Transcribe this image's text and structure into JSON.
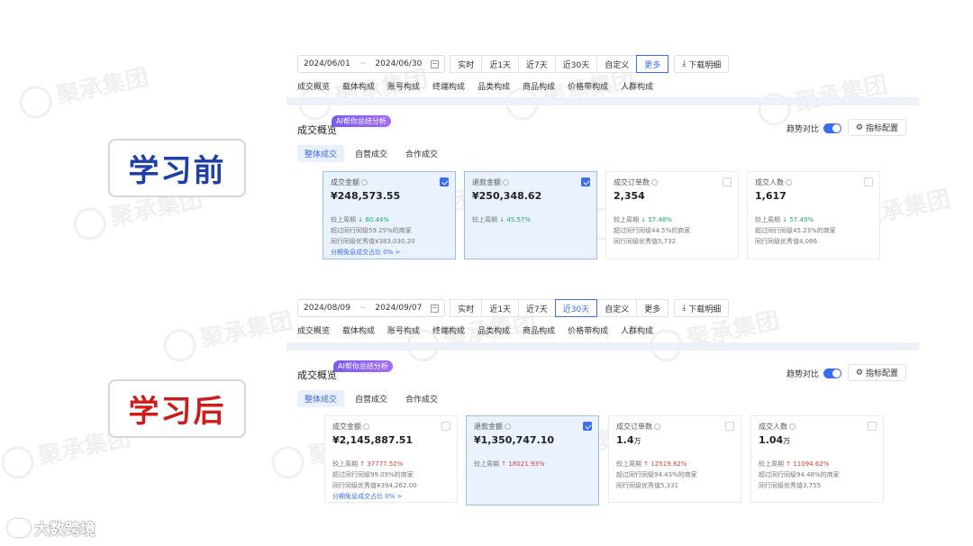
{
  "labels": {
    "before": "学习前",
    "after": "学习后"
  },
  "watermark_text": "聚承集团",
  "footer": {
    "text": "大数跨境"
  },
  "panels": [
    {
      "date_start": "2024/06/01",
      "date_end": "2024/06/30",
      "ranges": [
        "实时",
        "近1天",
        "近7天",
        "近30天",
        "自定义",
        "更多"
      ],
      "active_range": 5,
      "download": "下载明细",
      "subtabs": [
        "成交概览",
        "载体构成",
        "账号构成",
        "终端构成",
        "品类构成",
        "商品构成",
        "价格带构成",
        "人群构成"
      ],
      "section_title": "成交概览",
      "ai_badge": "AI帮你总结分析",
      "trend_label": "趋势对比",
      "config_label": "指标配置",
      "content_tabs": [
        "整体成交",
        "自营成交",
        "合作成交"
      ],
      "cards": [
        {
          "title": "成交金额",
          "value": "¥248,573.55",
          "unit": "",
          "selected": true,
          "change_prefix": "较上周期",
          "change": "60.44%",
          "direction": "down",
          "lines": [
            "超过同行同级59.25%的商家",
            "同行同级优秀值¥383,030.20"
          ],
          "link": "分期免息成交占比 0% >"
        },
        {
          "title": "退款金额",
          "value": "¥250,348.62",
          "unit": "",
          "selected": true,
          "change_prefix": "较上周期",
          "change": "45.57%",
          "direction": "down",
          "lines": [],
          "link": ""
        },
        {
          "title": "成交订单数",
          "value": "2,354",
          "unit": "",
          "selected": false,
          "change_prefix": "较上周期",
          "change": "57.48%",
          "direction": "down",
          "lines": [
            "超过同行同级44.5%的商家",
            "同行同级优秀值5,732"
          ],
          "link": ""
        },
        {
          "title": "成交人数",
          "value": "1,617",
          "unit": "",
          "selected": false,
          "change_prefix": "较上周期",
          "change": "57.49%",
          "direction": "down",
          "lines": [
            "超过同行同级45.23%的商家",
            "同行同级优秀值4,066"
          ],
          "link": ""
        }
      ]
    },
    {
      "date_start": "2024/08/09",
      "date_end": "2024/09/07",
      "ranges": [
        "实时",
        "近1天",
        "近7天",
        "近30天",
        "自定义",
        "更多"
      ],
      "active_range": 3,
      "download": "下载明细",
      "subtabs": [
        "成交概览",
        "载体构成",
        "账号构成",
        "终端构成",
        "品类构成",
        "商品构成",
        "价格带构成",
        "人群构成"
      ],
      "section_title": "成交概览",
      "ai_badge": "AI帮你总结分析",
      "trend_label": "趋势对比",
      "config_label": "指标配置",
      "content_tabs": [
        "整体成交",
        "自营成交",
        "合作成交"
      ],
      "cards": [
        {
          "title": "成交金额",
          "value": "¥2,145,887.51",
          "unit": "",
          "selected": false,
          "change_prefix": "较上周期",
          "change": "37777.52%",
          "direction": "up",
          "lines": [
            "超过同行同级99.09%的商家",
            "同行同级优秀值¥394,262.00"
          ],
          "link": "分期免息成交占比 0% >"
        },
        {
          "title": "退款金额",
          "value": "¥1,350,747.10",
          "unit": "",
          "selected": true,
          "change_prefix": "较上周期",
          "change": "18021.93%",
          "direction": "up",
          "lines": [],
          "link": ""
        },
        {
          "title": "成交订单数",
          "value": "1.4",
          "unit": "万",
          "selected": false,
          "change_prefix": "较上周期",
          "change": "12519.82%",
          "direction": "up",
          "lines": [
            "超过同行同级94.43%的商家",
            "同行同级优秀值5,331"
          ],
          "link": ""
        },
        {
          "title": "成交人数",
          "value": "1.04",
          "unit": "万",
          "selected": false,
          "change_prefix": "较上周期",
          "change": "11094.62%",
          "direction": "up",
          "lines": [
            "超过同行同级94.48%的商家",
            "同行同级优秀值3,755"
          ],
          "link": ""
        }
      ]
    }
  ]
}
